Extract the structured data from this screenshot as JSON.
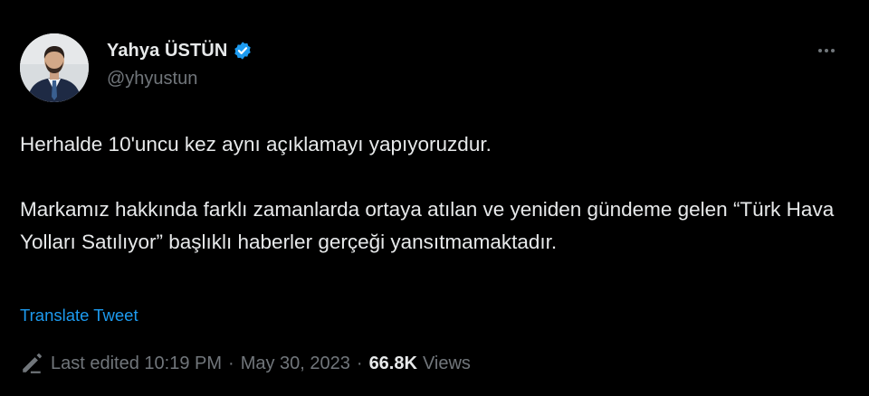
{
  "author": {
    "display_name": "Yahya ÜSTÜN",
    "handle": "@yhyustun",
    "verified_icon": "verified-badge-icon",
    "avatar": "profile-photo"
  },
  "menu": {
    "more_icon": "more-options-icon"
  },
  "tweet": {
    "lines": [
      "Herhalde 10'uncu kez aynı açıklamayı yapıyoruzdur.",
      "Markamız hakkında farklı zamanlarda ortaya atılan ve yeniden gündeme gelen “Türk Hava Yolları Satılıyor” başlıklı haberler gerçeği yansıtmamaktadır."
    ],
    "translate_label": "Translate Tweet"
  },
  "meta": {
    "edit_icon": "pencil-icon",
    "edited_label": "Last edited 10:19 PM",
    "separator": "·",
    "date": "May 30, 2023",
    "views_count": "66.8K",
    "views_label": "Views"
  },
  "colors": {
    "background": "#000000",
    "text_primary": "#e7e9ea",
    "text_secondary": "#71767b",
    "accent": "#1d9bf0"
  }
}
